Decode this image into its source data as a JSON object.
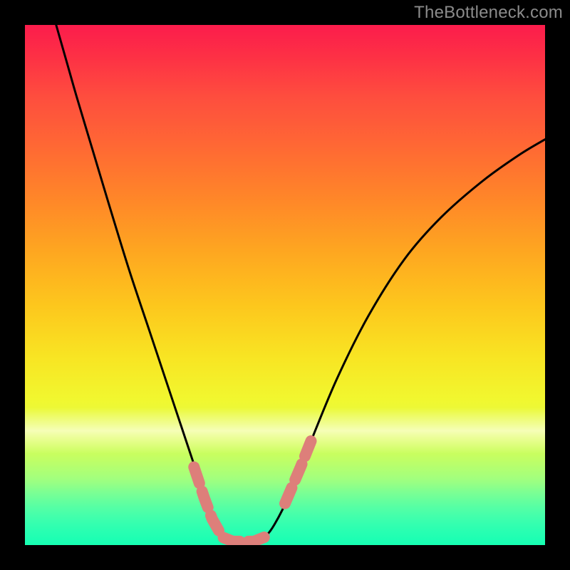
{
  "watermark": {
    "text": "TheBottleneck.com"
  },
  "chart_data": {
    "type": "line",
    "title": "",
    "xlabel": "",
    "ylabel": "",
    "xlim": [
      0,
      100
    ],
    "ylim": [
      0,
      100
    ],
    "grid": false,
    "legend": null,
    "series": [
      {
        "name": "bottleneck-curve",
        "stroke": "#000000",
        "points": [
          {
            "x": 6,
            "y": 100
          },
          {
            "x": 8,
            "y": 93
          },
          {
            "x": 10,
            "y": 86
          },
          {
            "x": 13,
            "y": 76
          },
          {
            "x": 16,
            "y": 66
          },
          {
            "x": 20,
            "y": 53
          },
          {
            "x": 24,
            "y": 41
          },
          {
            "x": 28,
            "y": 29
          },
          {
            "x": 31,
            "y": 20
          },
          {
            "x": 34,
            "y": 11
          },
          {
            "x": 36,
            "y": 5
          },
          {
            "x": 38,
            "y": 1.5
          },
          {
            "x": 40,
            "y": 0.7
          },
          {
            "x": 44,
            "y": 0.7
          },
          {
            "x": 46,
            "y": 1.5
          },
          {
            "x": 48,
            "y": 4
          },
          {
            "x": 51,
            "y": 10
          },
          {
            "x": 55,
            "y": 20
          },
          {
            "x": 60,
            "y": 32
          },
          {
            "x": 66,
            "y": 44
          },
          {
            "x": 73,
            "y": 55
          },
          {
            "x": 80,
            "y": 63
          },
          {
            "x": 88,
            "y": 70
          },
          {
            "x": 95,
            "y": 75
          },
          {
            "x": 100,
            "y": 78
          }
        ]
      },
      {
        "name": "highlight-segments-left",
        "stroke": "#dd7f7a",
        "dashed": true,
        "points": [
          {
            "x": 32.5,
            "y": 15
          },
          {
            "x": 34.5,
            "y": 9
          },
          {
            "x": 36,
            "y": 5
          },
          {
            "x": 38,
            "y": 1.5
          },
          {
            "x": 40,
            "y": 0.7
          },
          {
            "x": 44,
            "y": 0.7
          },
          {
            "x": 46,
            "y": 1.5
          }
        ]
      },
      {
        "name": "highlight-segments-right",
        "stroke": "#dd7f7a",
        "dashed": true,
        "points": [
          {
            "x": 50,
            "y": 8
          },
          {
            "x": 53,
            "y": 15
          },
          {
            "x": 55,
            "y": 20
          }
        ]
      }
    ],
    "background_gradient_stops": [
      {
        "pos": 0.0,
        "color": "#fc1c4c"
      },
      {
        "pos": 0.25,
        "color": "#ff7030"
      },
      {
        "pos": 0.55,
        "color": "#fecc1c"
      },
      {
        "pos": 0.72,
        "color": "#f2f82e"
      },
      {
        "pos": 0.88,
        "color": "#9bff82"
      },
      {
        "pos": 1.0,
        "color": "#29ffc2"
      }
    ],
    "annotations": []
  }
}
